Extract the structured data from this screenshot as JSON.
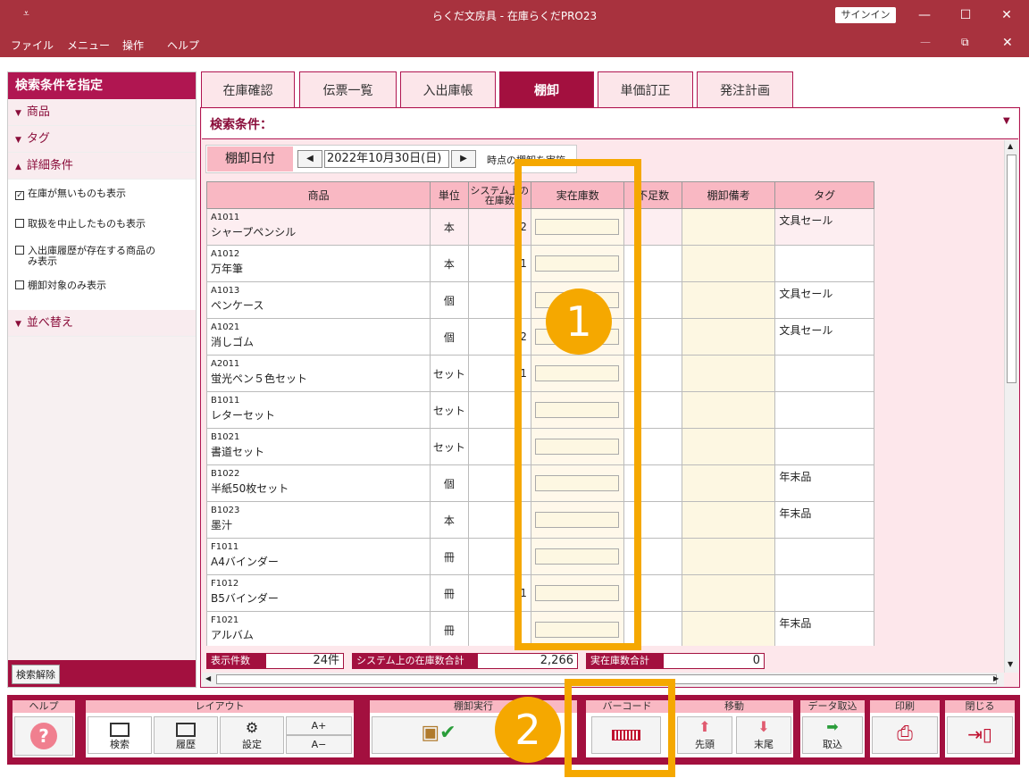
{
  "window": {
    "title": "らくだ文房具 - 在庫らくだPRO23",
    "signin": "サインイン",
    "min": "—",
    "max": "☐",
    "close": "✕",
    "restore": "⧉"
  },
  "menu": [
    "ファイル",
    "メニュー",
    "操作",
    "ヘルプ"
  ],
  "sidebar": {
    "header": "検索条件を指定",
    "sections": [
      "商品",
      "タグ",
      "詳細条件",
      "並べ替え"
    ],
    "checks": [
      {
        "label": "在庫が無いものも表示",
        "checked": true
      },
      {
        "label": "取扱を中止したものも表示",
        "checked": false
      },
      {
        "label": "入出庫履歴が存在する商品のみ表示",
        "checked": false
      },
      {
        "label": "棚卸対象のみ表示",
        "checked": false
      }
    ],
    "clear_button": "検索解除"
  },
  "tabs": [
    "在庫確認",
    "伝票一覧",
    "入出庫帳",
    "棚卸",
    "単価訂正",
    "発注計画"
  ],
  "active_tab": "棚卸",
  "search_cond": "検索条件：",
  "date": {
    "label": "棚卸日付",
    "value": "2022年10月30日(日)",
    "suffix": "時点の棚卸を実施"
  },
  "columns": [
    "商品",
    "単位",
    "システム上の在庫数",
    "実在庫数",
    "不足数",
    "棚卸備考",
    "タグ"
  ],
  "rows": [
    {
      "code": "A1011",
      "name": "シャープペンシル",
      "unit": "本",
      "sys": "2",
      "tag": "文具セール"
    },
    {
      "code": "A1012",
      "name": "万年筆",
      "unit": "本",
      "sys": "1",
      "tag": ""
    },
    {
      "code": "A1013",
      "name": "ペンケース",
      "unit": "個",
      "sys": "",
      "tag": "文具セール"
    },
    {
      "code": "A1021",
      "name": "消しゴム",
      "unit": "個",
      "sys": "2",
      "tag": "文具セール"
    },
    {
      "code": "A2011",
      "name": "蛍光ペン５色セット",
      "unit": "セット",
      "sys": "1",
      "tag": ""
    },
    {
      "code": "B1011",
      "name": "レターセット",
      "unit": "セット",
      "sys": "",
      "tag": ""
    },
    {
      "code": "B1021",
      "name": "書道セット",
      "unit": "セット",
      "sys": "",
      "tag": ""
    },
    {
      "code": "B1022",
      "name": "半紙50枚セット",
      "unit": "個",
      "sys": "",
      "tag": "年末品"
    },
    {
      "code": "B1023",
      "name": "墨汁",
      "unit": "本",
      "sys": "",
      "tag": "年末品"
    },
    {
      "code": "F1011",
      "name": "A4バインダー",
      "unit": "冊",
      "sys": "",
      "tag": ""
    },
    {
      "code": "F1012",
      "name": "B5バインダー",
      "unit": "冊",
      "sys": "1",
      "tag": ""
    },
    {
      "code": "F1021",
      "name": "アルバム",
      "unit": "冊",
      "sys": "",
      "tag": "年末品"
    }
  ],
  "summary": {
    "count_label": "表示件数",
    "count": "24件",
    "sys_total_label": "システム上の在庫数合計",
    "sys_total": "2,266",
    "real_total_label": "実在庫数合計",
    "real_total": "0"
  },
  "toolbar": {
    "help": {
      "label": "ヘルプ"
    },
    "layout": {
      "label": "レイアウト",
      "search": "検索",
      "history": "履歴",
      "settings": "設定",
      "font_up": "A+",
      "font_down": "A−"
    },
    "exec": {
      "label": "棚卸実行"
    },
    "barcode": {
      "label": "バーコード"
    },
    "move": {
      "label": "移動",
      "first": "先頭",
      "last": "末尾"
    },
    "import": {
      "label": "データ取込",
      "btn": "取込"
    },
    "print": {
      "label": "印刷"
    },
    "close": {
      "label": "閉じる"
    }
  },
  "badges": [
    "1",
    "2"
  ],
  "colors": {
    "accent": "#a3103f",
    "title": "#a8323e",
    "highlight": "#f5a800"
  }
}
